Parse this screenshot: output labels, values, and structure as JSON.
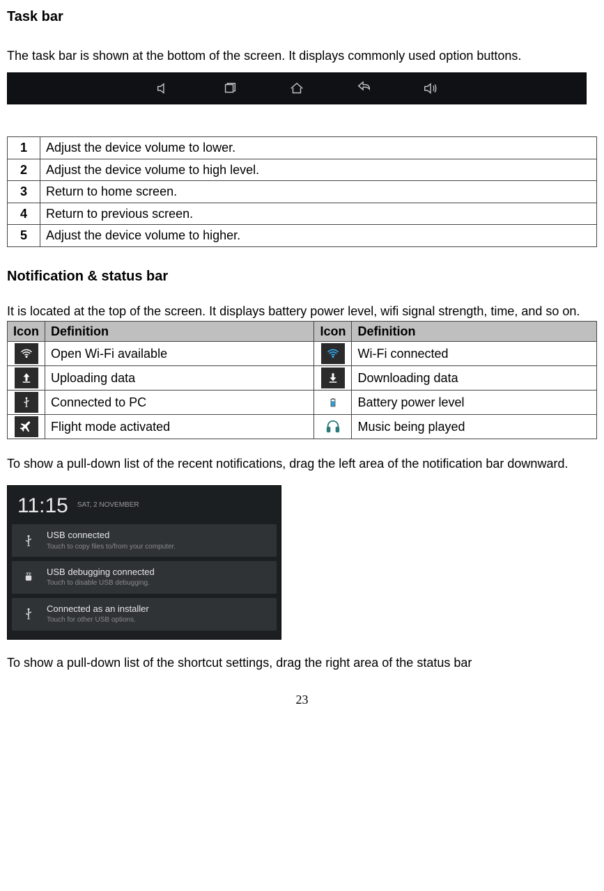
{
  "sections": {
    "taskbar_title": "Task bar",
    "taskbar_desc": "The task bar is shown at the bottom of the screen. It displays commonly used option buttons.",
    "notif_title": "Notification & status bar",
    "notif_desc": "It is located at the top of the screen. It displays battery power level, wifi signal strength, time, and so on.",
    "pulldown_left": "To show a pull-down list of the recent notifications, drag the left area of the notification bar downward.",
    "pulldown_right": "To show a pull-down list of the shortcut settings, drag the right area of the status bar"
  },
  "taskbar_rows": [
    {
      "n": "1",
      "def": "Adjust the device volume to lower."
    },
    {
      "n": "2",
      "def": "Adjust the device volume to high level."
    },
    {
      "n": "3",
      "def": "Return to home screen."
    },
    {
      "n": "4",
      "def": "Return to previous screen."
    },
    {
      "n": "5",
      "def": "Adjust the device volume to higher."
    }
  ],
  "icon_headers": {
    "icon": "Icon",
    "def": "Definition"
  },
  "icon_rows": [
    {
      "left": "Open Wi-Fi available",
      "right": "Wi-Fi connected"
    },
    {
      "left": "Uploading data",
      "right": "Downloading data"
    },
    {
      "left": "Connected to PC",
      "right": "Battery power level"
    },
    {
      "left": "Flight mode activated",
      "right": "Music being played"
    }
  ],
  "notif_shot": {
    "time": "11:15",
    "date": "SAT, 2 NOVEMBER",
    "items": [
      {
        "title": "USB connected",
        "sub": "Touch to copy files to/from your computer."
      },
      {
        "title": "USB debugging connected",
        "sub": "Touch to disable USB debugging."
      },
      {
        "title": "Connected as an installer",
        "sub": "Touch for other USB options."
      }
    ]
  },
  "page_number": "23"
}
